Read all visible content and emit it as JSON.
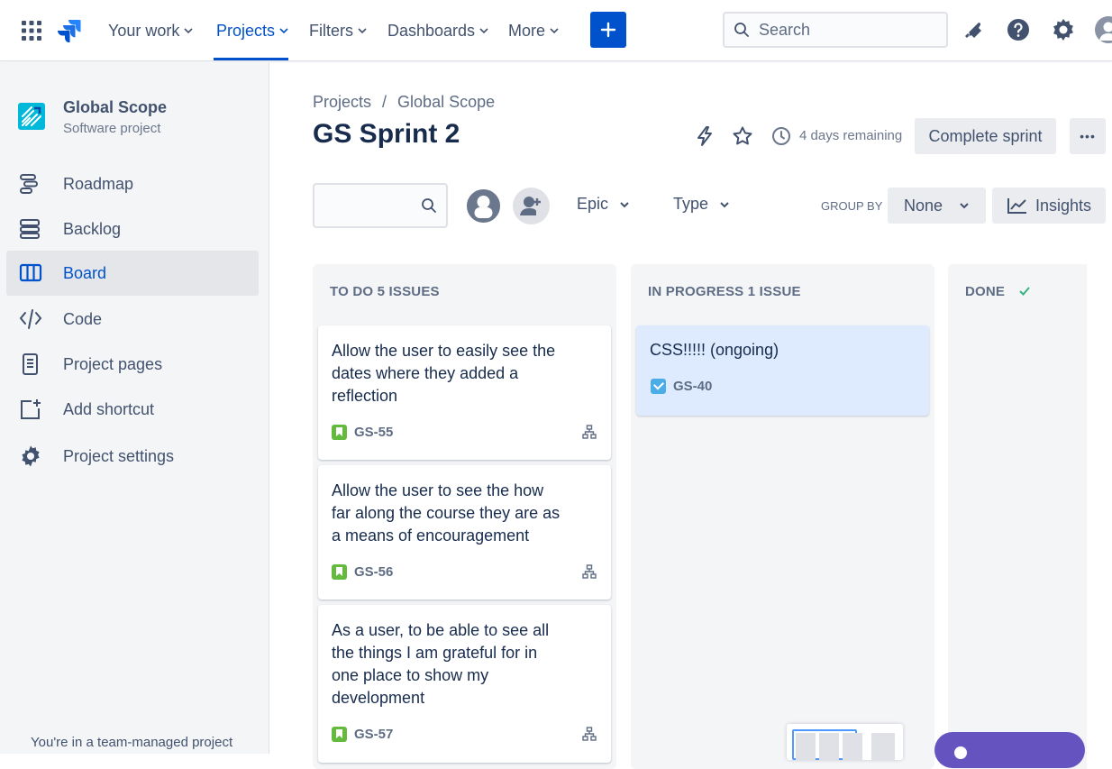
{
  "topnav": {
    "items": [
      {
        "label": "Your work"
      },
      {
        "label": "Projects"
      },
      {
        "label": "Filters"
      },
      {
        "label": "Dashboards"
      },
      {
        "label": "More"
      }
    ],
    "search_placeholder": "Search",
    "accent": "#0052cc"
  },
  "sidebar": {
    "project_name": "Global Scope",
    "project_type": "Software project",
    "items": [
      {
        "label": "Roadmap",
        "icon": "roadmap-icon"
      },
      {
        "label": "Backlog",
        "icon": "backlog-icon"
      },
      {
        "label": "Board",
        "icon": "board-icon"
      },
      {
        "label": "Code",
        "icon": "code-icon"
      },
      {
        "label": "Project pages",
        "icon": "page-icon"
      },
      {
        "label": "Add shortcut",
        "icon": "add-shortcut-icon"
      },
      {
        "label": "Project settings",
        "icon": "gear-icon"
      }
    ],
    "active_item": "Board",
    "footer_note": "You're in a team-managed project"
  },
  "main": {
    "breadcrumb": [
      "Projects",
      "Global Scope"
    ],
    "breadcrumb_sep": "/",
    "title": "GS Sprint 2",
    "days_remaining": "4 days remaining",
    "complete_sprint": "Complete sprint",
    "more_label": "•••",
    "filters": {
      "epic": "Epic",
      "type": "Type",
      "group_by_label": "GROUP BY",
      "group_by_value": "None",
      "insights": "Insights"
    }
  },
  "board": {
    "columns": [
      {
        "title": "TO DO 5 ISSUES",
        "cards": [
          {
            "summary": "Allow the user to easily see the dates where they added a reflection",
            "key": "GS-55",
            "type": "story"
          },
          {
            "summary": "Allow the user to see the how far along the course they are as a means of encouragement",
            "key": "GS-56",
            "type": "story"
          },
          {
            "summary": "As a user, to be able to see all the things I am grateful for in one place to show my development",
            "key": "GS-57",
            "type": "story"
          }
        ]
      },
      {
        "title": "IN PROGRESS 1 ISSUE",
        "cards": [
          {
            "summary": "CSS!!!!! (ongoing)",
            "key": "GS-40",
            "type": "task"
          }
        ]
      },
      {
        "title": "DONE",
        "cards": []
      }
    ]
  }
}
